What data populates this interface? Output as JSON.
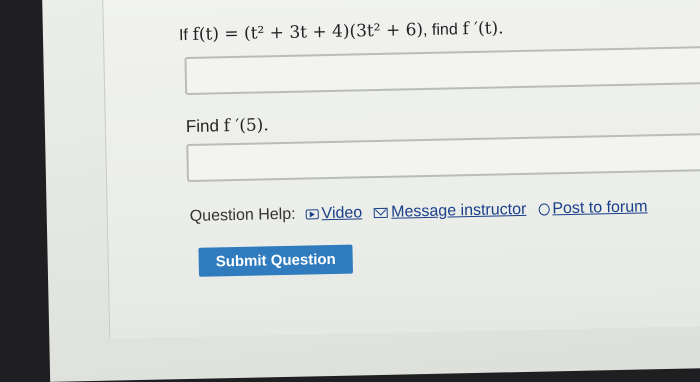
{
  "question1": {
    "prefix": "If",
    "math": "f(t) = (t² + 3t + 4)(3t² + 6)",
    "mid": ", find",
    "target": "f ′(t)",
    "suffix": "."
  },
  "question2": {
    "prefix": "Find",
    "target": "f ′(5)",
    "suffix": "."
  },
  "answer1_value": "",
  "answer2_value": "",
  "help": {
    "label": "Question Help:",
    "video": "Video",
    "message": "Message instructor",
    "forum": "Post to forum"
  },
  "submit_label": "Submit Question",
  "colors": {
    "link": "#1a3f8a",
    "submit_bg": "#2f7bbd"
  }
}
